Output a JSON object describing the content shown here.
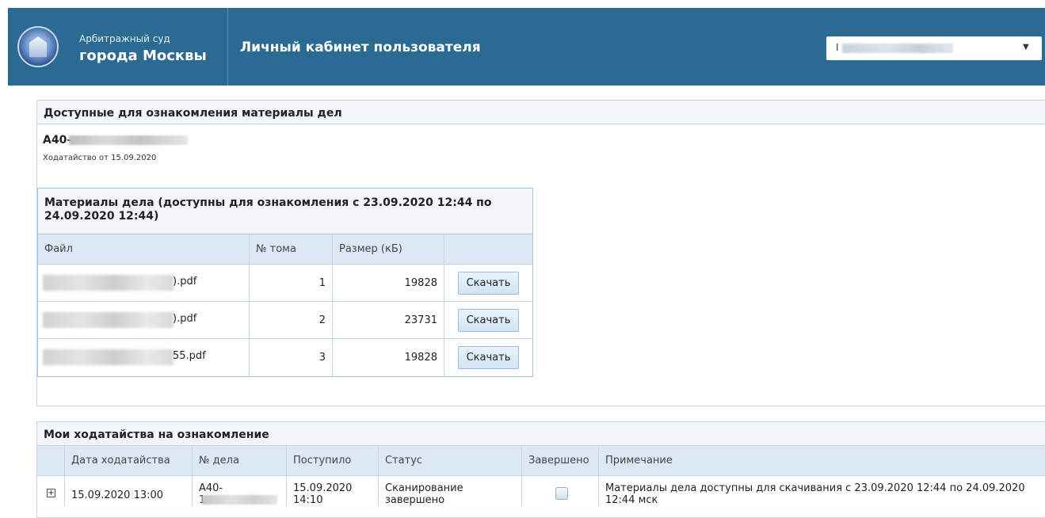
{
  "header": {
    "court_line1": "Арбитражный суд",
    "court_line2": "города Москвы",
    "cabinet_title": "Личный кабинет пользователя",
    "user_prefix": "I"
  },
  "available": {
    "title": "Доступные для ознакомления материалы дел",
    "case_number_prefix": "А40-",
    "petition_note": "Ходатайство от 15.09.2020",
    "materials": {
      "title": "Материалы дела (доступны для ознакомления с 23.09.2020 12:44 по 24.09.2020 12:44)",
      "columns": [
        "Файл",
        "№ тома",
        "Размер (кБ)"
      ],
      "rows": [
        {
          "file_suffix": ").pdf",
          "volume": "1",
          "size": "19828",
          "action": "Скачать"
        },
        {
          "file_suffix": ").pdf",
          "volume": "2",
          "size": "23731",
          "action": "Скачать"
        },
        {
          "file_suffix": "55.pdf",
          "volume": "3",
          "size": "19828",
          "action": "Скачать"
        }
      ]
    }
  },
  "petitions": {
    "title": "Мои ходатайства на ознакомление",
    "columns": [
      "Дата ходатайства",
      "№ дела",
      "Поступило",
      "Статус",
      "Завершено",
      "Примечание"
    ],
    "rows": [
      {
        "date": "15.09.2020 13:00",
        "case_prefix": "А40-",
        "case_line2": "1",
        "received": "15.09.2020 14:10",
        "status": "Сканирование завершено",
        "done_checked": false,
        "note": "Материалы дела доступны для скачивания с 23.09.2020 12:44 по 24.09.2020 12:44 мск"
      }
    ]
  },
  "colors": {
    "header_bg": "#2b6a92",
    "table_header_bg": "#dce9f5",
    "panel_head_bg": "#f2f6fa",
    "border": "#c5d7e6"
  }
}
